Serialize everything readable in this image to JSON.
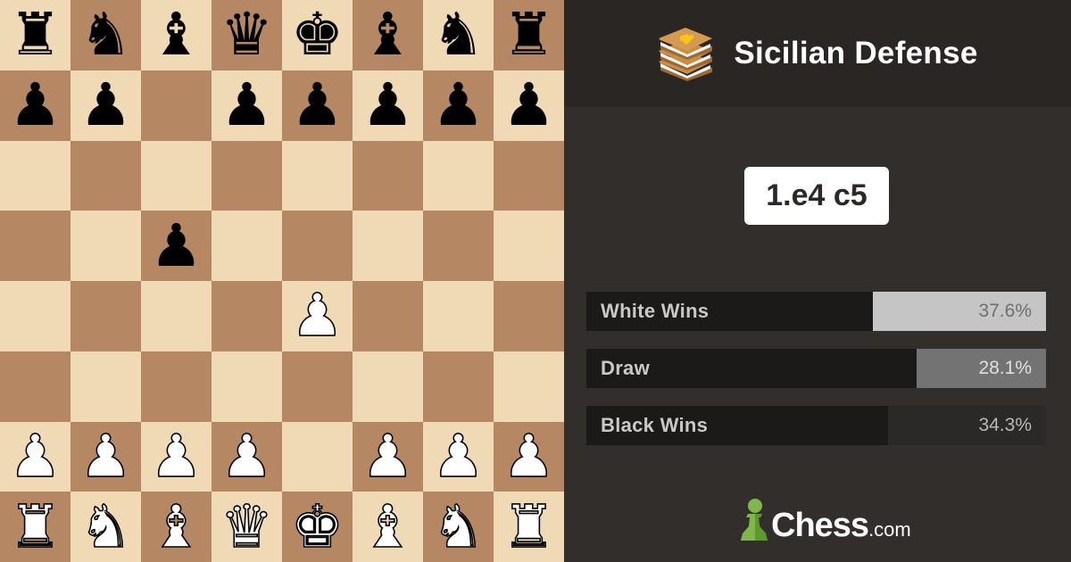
{
  "opening": {
    "name": "Sicilian Defense",
    "moves": "1.e4 c5",
    "icon": "book-stack-icon"
  },
  "board": {
    "colors": {
      "light": "#f0d9b5",
      "dark": "#b58863"
    },
    "ranks": [
      [
        "bR",
        "bN",
        "bB",
        "bQ",
        "bK",
        "bB",
        "bN",
        "bR"
      ],
      [
        "bP",
        "bP",
        "",
        "bP",
        "bP",
        "bP",
        "bP",
        "bP"
      ],
      [
        "",
        "",
        "",
        "",
        "",
        "",
        "",
        ""
      ],
      [
        "",
        "",
        "bP",
        "",
        "",
        "",
        "",
        ""
      ],
      [
        "",
        "",
        "",
        "",
        "wP",
        "",
        "",
        ""
      ],
      [
        "",
        "",
        "",
        "",
        "",
        "",
        "",
        ""
      ],
      [
        "wP",
        "wP",
        "wP",
        "wP",
        "",
        "wP",
        "wP",
        "wP"
      ],
      [
        "wR",
        "wN",
        "wB",
        "wQ",
        "wK",
        "wB",
        "wN",
        "wR"
      ]
    ]
  },
  "stats": [
    {
      "id": "white",
      "label": "White Wins",
      "value_text": "37.6%",
      "percent": 37.6
    },
    {
      "id": "draw",
      "label": "Draw",
      "value_text": "28.1%",
      "percent": 28.1
    },
    {
      "id": "black",
      "label": "Black Wins",
      "value_text": "34.3%",
      "percent": 34.3
    }
  ],
  "brand": {
    "name": "Chess",
    "tld": ".com",
    "icon": "pawn-logo-icon",
    "color": "#81b64c"
  }
}
